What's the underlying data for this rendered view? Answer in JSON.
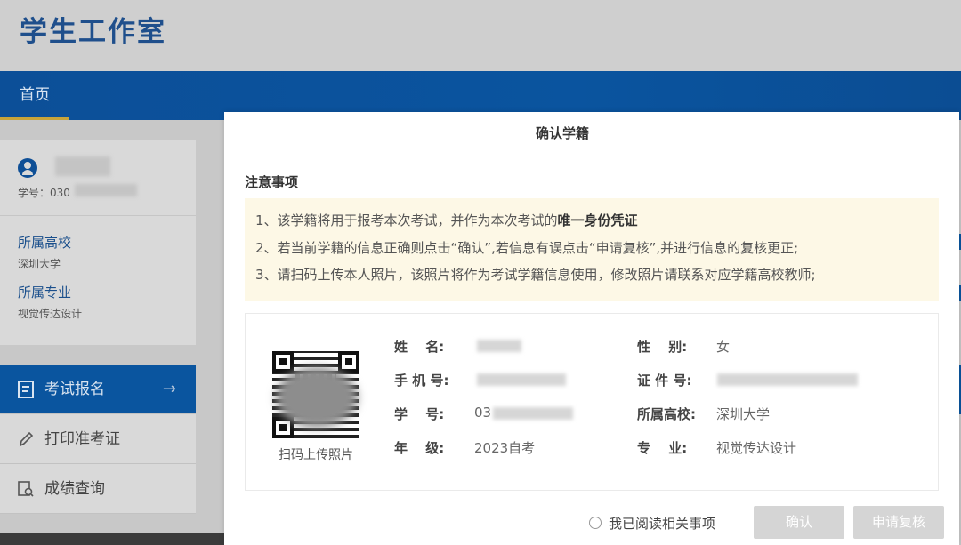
{
  "app": {
    "title": "学生工作室"
  },
  "nav": {
    "home": "首页"
  },
  "profile": {
    "student_id_label": "学号：030",
    "school_title": "所属高校",
    "school_value": "深圳大学",
    "major_title": "所属专业",
    "major_value": "视觉传达设计"
  },
  "menu": {
    "items": [
      {
        "label": "考试报名",
        "icon": "register-icon",
        "active": true
      },
      {
        "label": "打印准考证",
        "icon": "pencil-icon",
        "active": false
      },
      {
        "label": "成绩查询",
        "icon": "search-doc-icon",
        "active": false
      }
    ],
    "arrow": "→"
  },
  "modal": {
    "title": "确认学籍",
    "notice_heading": "注意事项",
    "notices": {
      "n1_prefix": "1、该学籍将用于报考本次考试，并作为本次考试的",
      "n1_bold": "唯一身份凭证",
      "n2": "2、若当前学籍的信息正确则点击“确认”,若信息有误点击“申请复核”,并进行信息的复核更正;",
      "n3": "3、请扫码上传本人照片，该照片将作为考试学籍信息使用，修改照片请联系对应学籍高校教师;"
    },
    "qr_caption": "扫码上传照片",
    "fields": {
      "name_label": "姓　 名:",
      "phone_label": "手 机 号:",
      "sid_label": "学　 号:",
      "sid_value": "03",
      "grade_label": "年　 级:",
      "grade_value": "2023自考",
      "gender_label": "性　 别:",
      "gender_value": "女",
      "idno_label": "证 件 号:",
      "school_label": "所属高校:",
      "school_value": "深圳大学",
      "major_label": "专　 业:",
      "major_value": "视觉传达设计"
    },
    "agree_label": "我已阅读相关事项",
    "confirm_button": "确认",
    "review_button": "申请复核"
  }
}
